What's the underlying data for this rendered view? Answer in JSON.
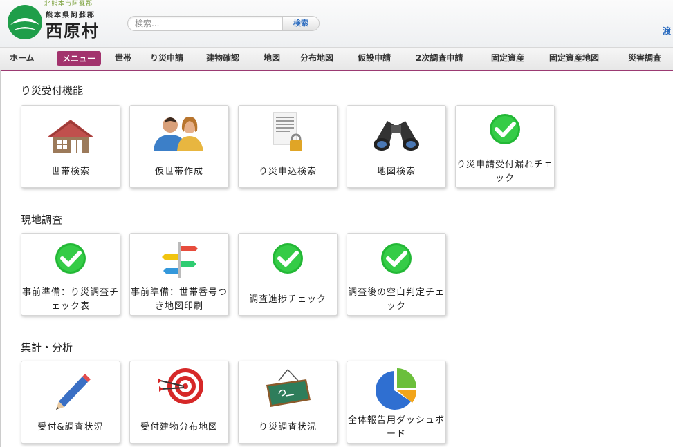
{
  "header": {
    "pref_tag": "北熊本市阿蘇郡",
    "prefecture": "熊本県阿蘇郡",
    "village": "西原村",
    "search_placeholder": "検索...",
    "search_button": "検索",
    "user_link": "渡"
  },
  "nav": {
    "items": [
      "ホーム",
      "メニュー",
      "世帯",
      "り災申請",
      "建物確認",
      "地図",
      "分布地図",
      "仮設申請",
      "2次調査申請",
      "固定資産",
      "固定資産地図",
      "災害調査"
    ],
    "active_index": 1
  },
  "sections": [
    {
      "title": "り災受付機能",
      "cards": [
        {
          "label": "世帯検索",
          "icon": "house-icon"
        },
        {
          "label": "仮世帯作成",
          "icon": "people-icon"
        },
        {
          "label": "り災申込検索",
          "icon": "locked-document-icon"
        },
        {
          "label": "地図検索",
          "icon": "binoculars-icon"
        },
        {
          "label": "り災申請受付漏れチェック",
          "icon": "check-circle-icon"
        }
      ]
    },
    {
      "title": "現地調査",
      "cards": [
        {
          "label": "事前準備：り災調査チェック表",
          "icon": "check-circle-icon"
        },
        {
          "label": "事前準備：世帯番号つき地図印刷",
          "icon": "signpost-icon"
        },
        {
          "label": "調査進捗チェック",
          "icon": "check-circle-icon"
        },
        {
          "label": "調査後の空白判定チェック",
          "icon": "check-circle-icon"
        }
      ]
    },
    {
      "title": "集計・分析",
      "cards": [
        {
          "label": "受付&調査状況",
          "icon": "pencil-icon"
        },
        {
          "label": "受付建物分布地図",
          "icon": "target-icon"
        },
        {
          "label": "り災調査状況",
          "icon": "chalkboard-icon"
        },
        {
          "label": "全体報告用ダッシュボード",
          "icon": "pie-chart-icon"
        }
      ]
    }
  ],
  "colors": {
    "accent": "#a2336d",
    "link": "#2a6bbf",
    "check": "#2ecc40",
    "logo": "#1f9e4a"
  }
}
